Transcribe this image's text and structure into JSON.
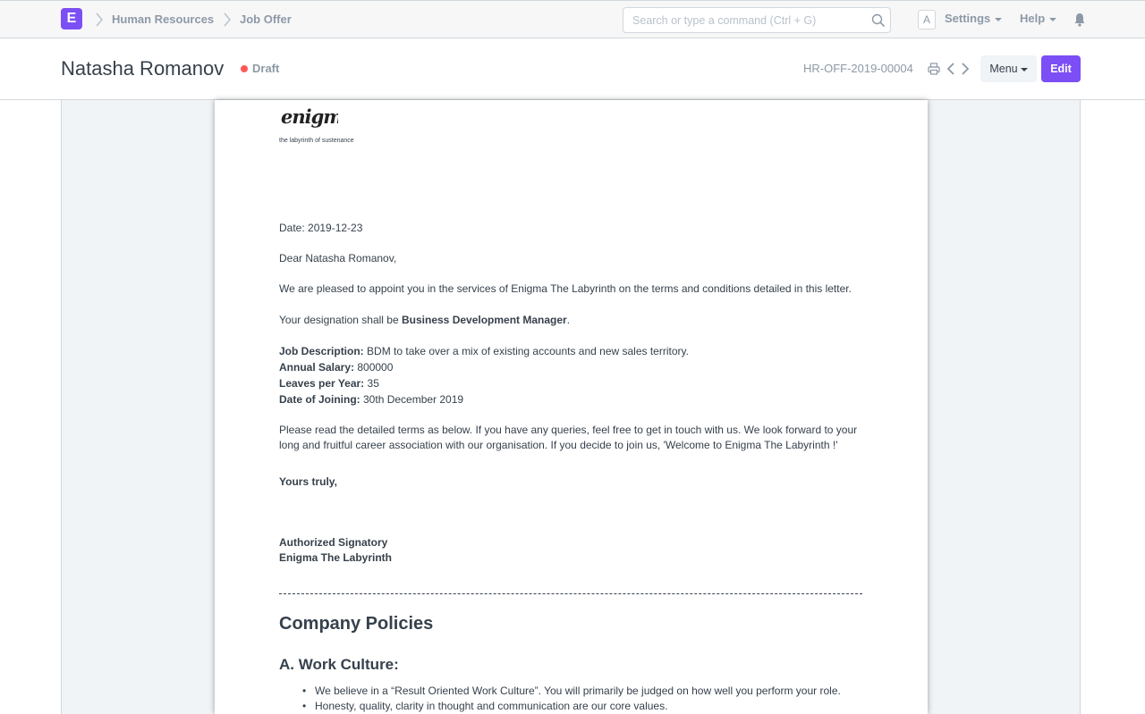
{
  "navbar": {
    "app_letter": "E",
    "breadcrumbs": [
      "Human Resources",
      "Job Offer"
    ],
    "search_placeholder": "Search or type a command (Ctrl + G)",
    "avatar_letter": "A",
    "settings_label": "Settings",
    "help_label": "Help"
  },
  "page_head": {
    "title": "Natasha Romanov",
    "status": "Draft",
    "doc_name": "HR-OFF-2019-00004",
    "menu_label": "Menu",
    "edit_label": "Edit"
  },
  "letter": {
    "logo_text": "enigma",
    "tagline": "the labyrinth of sustenance",
    "date": "Date: 2019-12-23",
    "salutation": "Dear Natasha Romanov,",
    "intro": "We are pleased to appoint you in the services of Enigma The Labyrinth on the terms and conditions detailed in this letter.",
    "designation_prefix": "Your designation shall be ",
    "designation": "Business Development Manager",
    "designation_suffix": ".",
    "details": [
      {
        "label": "Job Description:",
        "value": " BDM to take over a mix of existing accounts and new sales territory."
      },
      {
        "label": "Annual Salary:",
        "value": " 800000"
      },
      {
        "label": "Leaves per Year:",
        "value": " 35"
      },
      {
        "label": "Date of Joining:",
        "value": " 30th December 2019"
      }
    ],
    "closing_para_1": "Please read the detailed terms as below. If you have any queries, feel free to get in touch with us. We look forward to your",
    "closing_para_2": "long and fruitful career association with our organisation. If you decide to join us, 'Welcome to Enigma The Labyrinth !'",
    "signoff": "Yours truly,",
    "signatory": "Authorized Signatory",
    "company": "Enigma The Labyrinth"
  },
  "policies": {
    "title": "Company Policies",
    "section_a_title": "A. Work Culture:",
    "section_a_items": [
      "We believe in a “Result Oriented Work Culture”. You will primarily be judged on how well you perform your role.",
      "Honesty, quality, clarity in thought and communication are our core values."
    ]
  },
  "colors": {
    "brand": "#7b4ef6",
    "status_draft": "#ff5858",
    "text": "#36414c",
    "muted": "#8d99a6"
  },
  "icons": [
    "app-logo-icon",
    "chevron-right-icon",
    "search-icon",
    "caret-down-icon",
    "bell-icon",
    "printer-icon",
    "chevron-left-icon"
  ]
}
